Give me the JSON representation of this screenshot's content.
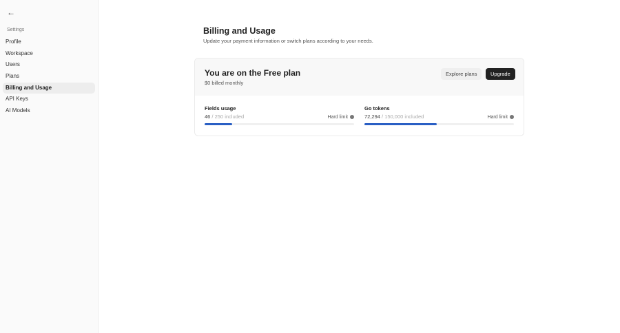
{
  "sidebar": {
    "back_icon": "arrow-left-icon",
    "section": "Settings",
    "items": [
      {
        "label": "Profile"
      },
      {
        "label": "Workspace"
      },
      {
        "label": "Users"
      },
      {
        "label": "Plans"
      },
      {
        "label": "Billing and Usage"
      },
      {
        "label": "API Keys"
      },
      {
        "label": "AI Models"
      }
    ],
    "active": "Billing and Usage"
  },
  "page": {
    "title": "Billing and Usage",
    "subtitle": "Update your payment information or switch plans according to your needs."
  },
  "plan": {
    "title": "You are on the Free plan",
    "billing": "$0 billed monthly",
    "explore_label": "Explore plans",
    "upgrade_label": "Upgrade"
  },
  "usage": [
    {
      "label": "Fields usage",
      "used": "46",
      "included": " / 250 included",
      "limit": "Hard limit",
      "fraction": 0.184
    },
    {
      "label": "Go tokens",
      "used": "72,294",
      "included": " / 150,000 included",
      "limit": "Hard limit",
      "fraction": 0.482
    }
  ],
  "colors": {
    "accent": "#2a5fc4",
    "primary_button": "#222222"
  }
}
